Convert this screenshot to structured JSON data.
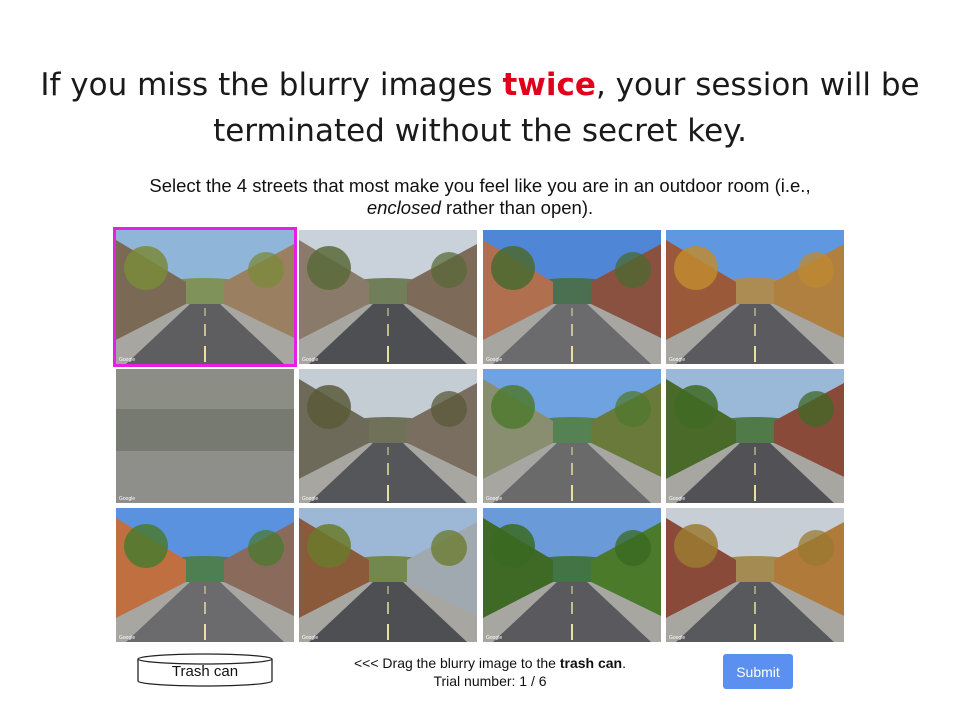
{
  "headline": {
    "part1": "If you miss the blurry images ",
    "emphasis": "twice",
    "part2": ", your session will be terminated without the secret key."
  },
  "instruction": {
    "part1": "Select the 4 streets that most make you feel like you are in an outdoor room (i.e., ",
    "italic": "enclosed",
    "part2": " rather than open)."
  },
  "grid": {
    "selected_index": 0,
    "watermark": "Google",
    "tiles": [
      {
        "label": "street-1",
        "sky": "#8fb5d8",
        "left": "#7a6a55",
        "right": "#9a8060",
        "road": "#5e5e60",
        "trees": "#7a8a3a",
        "selected": true
      },
      {
        "label": "street-2",
        "sky": "#c9d2da",
        "left": "#8a7a6a",
        "right": "#7e6a58",
        "road": "#4e4f53",
        "trees": "#5a6a3a",
        "selected": false
      },
      {
        "label": "street-3",
        "sky": "#4f86d6",
        "left": "#b07050",
        "right": "#8a5040",
        "road": "#6b6b6e",
        "trees": "#4a6a30",
        "selected": false
      },
      {
        "label": "street-4",
        "sky": "#5f97e0",
        "left": "#9a5a3a",
        "right": "#b08040",
        "road": "#5b5b5f",
        "trees": "#c08a30",
        "selected": false
      },
      {
        "label": "blurry-image",
        "sky": "#8c8e86",
        "left": "#7e8176",
        "right": "#7e8176",
        "road": "#8e8e8a",
        "trees": "#6e7268",
        "selected": false
      },
      {
        "label": "street-6",
        "sky": "#c4ccd4",
        "left": "#6e6a5a",
        "right": "#7a6e60",
        "road": "#55565a",
        "trees": "#5a5a3a",
        "selected": false
      },
      {
        "label": "street-7",
        "sky": "#6fa2e0",
        "left": "#8a8e70",
        "right": "#6a7a3a",
        "road": "#6a6a6a",
        "trees": "#4f7a2f",
        "selected": false
      },
      {
        "label": "street-8",
        "sky": "#9ab8d8",
        "left": "#4a6a2a",
        "right": "#8a4a3a",
        "road": "#525256",
        "trees": "#3f6a25",
        "selected": false
      },
      {
        "label": "street-9",
        "sky": "#5a92e0",
        "left": "#c07040",
        "right": "#8a6a5a",
        "road": "#6b6b6d",
        "trees": "#4a7a30",
        "selected": false
      },
      {
        "label": "street-10",
        "sky": "#9cb8d6",
        "left": "#8a5a3a",
        "right": "#a0a8b0",
        "road": "#4e4f53",
        "trees": "#6a7a2a",
        "selected": false
      },
      {
        "label": "street-11",
        "sky": "#6a9ad8",
        "left": "#3f6a25",
        "right": "#4a7a2a",
        "road": "#5a5a5e",
        "trees": "#3a6a22",
        "selected": false
      },
      {
        "label": "street-12",
        "sky": "#c7ced6",
        "left": "#8a4a3a",
        "right": "#b07a3a",
        "road": "#58595c",
        "trees": "#9a7a30",
        "selected": false
      }
    ]
  },
  "trash": {
    "label": "Trash can"
  },
  "footer": {
    "drag_prefix": "<<< Drag the blurry image to the ",
    "drag_bold": "trash can",
    "drag_suffix": ".",
    "trial_label": "Trial number: 1 / 6"
  },
  "submit": {
    "label": "Submit",
    "color": "#5b8ff0"
  },
  "colors": {
    "emphasis": "#e0001b",
    "selection": "#e61ee6"
  }
}
